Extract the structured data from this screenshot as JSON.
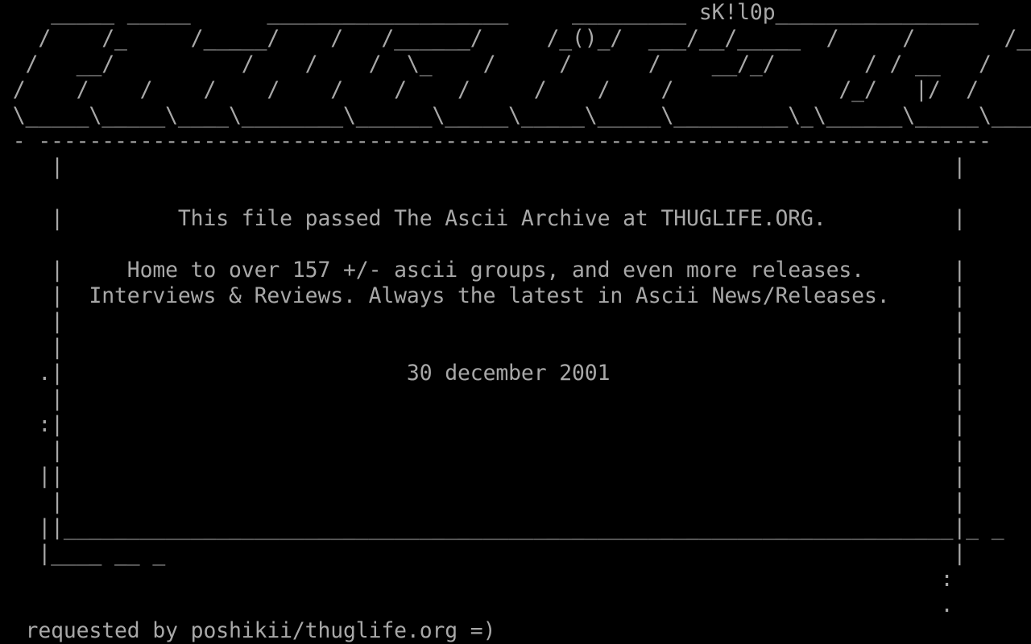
{
  "screen": {
    "colors": {
      "background": "#000000",
      "foreground": "#a8a8a8"
    },
    "art_lines": [
      "    _____ _____      ___________________     _________ sK!l0p________________",
      "   /    /_     /_____/    /   /______/     /_()_/  ___/__/_____  /     /       /______/",
      "  /   __/          /    /    /  \\_    /     /      /    __/_/       / / __   /    _      / \\_   /",
      " /    /    /    /    /    /    /    /     /    /    /             /_/   |/  /    |/  _/      /",
      " \\_____\\_____\\____\\________\\______\\_____\\_____\\_____\\_________\\_\\______\\_____\\____\\______\\",
      " - ---------------------------------------------------------------------------",
      "    |                                                                      |",
      "",
      "    |         This file passed The Ascii Archive at THUGLIFE.ORG.          |",
      "",
      "    |     Home to over 157 +/- ascii groups, and even more releases.       |",
      "    |  Interviews & Reviews. Always the latest in Ascii News/Releases.     |",
      "    |                                                                      |",
      "    |                                                                      |",
      "   .|                           30 december 2001                           |",
      "    |                                                                      |",
      "   :|                                                                      |",
      "    |                                                                      |",
      "   ||                                                                      |",
      "    |                                                                      |",
      "   ||______________________________________________________________________|_ _",
      "   |____ __ _                                                              |",
      "                                                                          :",
      "                                                                          .",
      "  requested by poshikii/thuglife.org =)"
    ]
  }
}
